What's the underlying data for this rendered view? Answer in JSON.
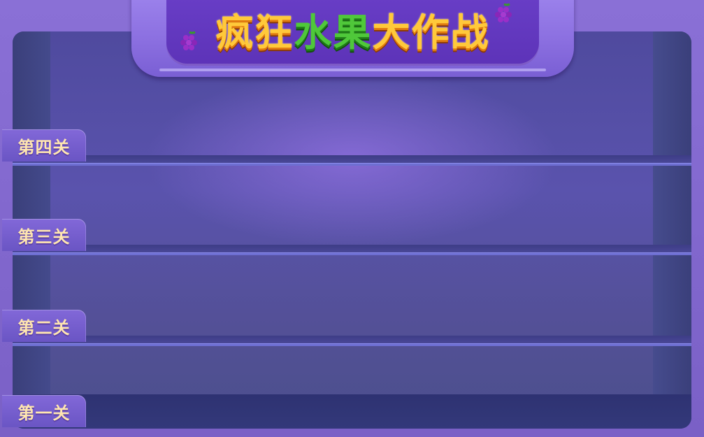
{
  "game": {
    "title_parts": [
      "疯狂",
      "水果",
      "大作战"
    ]
  },
  "levels": [
    {
      "label": "第四关"
    },
    {
      "label": "第三关"
    },
    {
      "label": "第二关"
    },
    {
      "label": "第一关"
    }
  ],
  "colors": {
    "background": "#7b62c8",
    "cabinet": "#3a3f7e",
    "tab_text": "#ffe6b0",
    "title_gold": "#ffc93a",
    "title_green": "#4fc83a"
  },
  "icons": [
    "grape-icon-left",
    "grape-icon-right"
  ]
}
